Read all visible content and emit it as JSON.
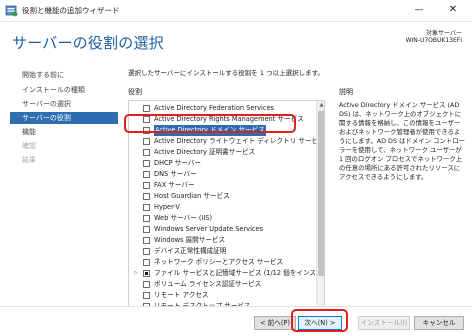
{
  "window": {
    "title": "役割と機能の追加ウィザード",
    "minimize_glyph": "—",
    "close_glyph": "✕",
    "icon": "server-manager-icon"
  },
  "header": {
    "page_title": "サーバーの役割の選択",
    "destination_label": "対象サーバー",
    "destination_server": "WIN-U7OBUK13EFI"
  },
  "nav": {
    "items": [
      {
        "label": "開始する前に",
        "state": "normal"
      },
      {
        "label": "インストールの種類",
        "state": "normal"
      },
      {
        "label": "サーバーの選択",
        "state": "normal"
      },
      {
        "label": "サーバーの役割",
        "state": "active"
      },
      {
        "label": "機能",
        "state": "normal"
      },
      {
        "label": "確認",
        "state": "disabled"
      },
      {
        "label": "結果",
        "state": "disabled"
      }
    ]
  },
  "main": {
    "instruction": "選択したサーバーにインストールする役割を 1 つ以上選択します。",
    "roles_header": "役割",
    "description_header": "説明",
    "description": "Active Directory ドメイン サービス (AD DS) は、ネットワーク上のオブジェクトに関する情報を格納し、この情報をユーザーおよびネットワーク管理者が使用できるようにします。AD DS はドメイン コントローラーを使用して、ネットワーク ユーザーが 1 回のログオン プロセスでネットワーク上の任意の場所にある許可されたリソースにアクセスできるようにします。",
    "roles": [
      {
        "label": "Active Directory Federation Services",
        "checked": false,
        "selected": false,
        "expandable": false
      },
      {
        "label": "Active Directory Rights Management サービス",
        "checked": false,
        "selected": false,
        "expandable": false
      },
      {
        "label": "Active Directory ドメイン サービス",
        "checked": false,
        "selected": true,
        "expandable": false
      },
      {
        "label": "Active Directory ライトウェイト ディレクトリ サービス",
        "checked": false,
        "selected": false,
        "expandable": false
      },
      {
        "label": "Active Directory 証明書サービス",
        "checked": false,
        "selected": false,
        "expandable": false
      },
      {
        "label": "DHCP サーバー",
        "checked": false,
        "selected": false,
        "expandable": false
      },
      {
        "label": "DNS サーバー",
        "checked": false,
        "selected": false,
        "expandable": false
      },
      {
        "label": "FAX サーバー",
        "checked": false,
        "selected": false,
        "expandable": false
      },
      {
        "label": "Host Guardian サービス",
        "checked": false,
        "selected": false,
        "expandable": false
      },
      {
        "label": "Hyper-V",
        "checked": false,
        "selected": false,
        "expandable": false
      },
      {
        "label": "Web サーバー (IIS)",
        "checked": false,
        "selected": false,
        "expandable": false
      },
      {
        "label": "Windows Server Update Services",
        "checked": false,
        "selected": false,
        "expandable": false
      },
      {
        "label": "Windows 展開サービス",
        "checked": false,
        "selected": false,
        "expandable": false
      },
      {
        "label": "デバイス正常性構成証明",
        "checked": false,
        "selected": false,
        "expandable": false
      },
      {
        "label": "ネットワーク ポリシーとアクセス サービス",
        "checked": false,
        "selected": false,
        "expandable": false
      },
      {
        "label": "ファイル サービスと記憶域サービス (1/12 個をインストール済み)",
        "checked": "partial",
        "selected": false,
        "expandable": true
      },
      {
        "label": "ボリューム ライセンス認証サービス",
        "checked": false,
        "selected": false,
        "expandable": false
      },
      {
        "label": "リモート アクセス",
        "checked": false,
        "selected": false,
        "expandable": false
      },
      {
        "label": "リモート デスクトップ サービス",
        "checked": false,
        "selected": false,
        "expandable": false
      }
    ]
  },
  "footer": {
    "prev_label": "< 前へ(P)",
    "next_label": "次へ(N) >",
    "install_label": "インストール(I)",
    "cancel_label": "キャンセル"
  },
  "colors": {
    "accent": "#2f6db1",
    "title_blue": "#1d5fa0",
    "annotation_red": "#e02020"
  }
}
